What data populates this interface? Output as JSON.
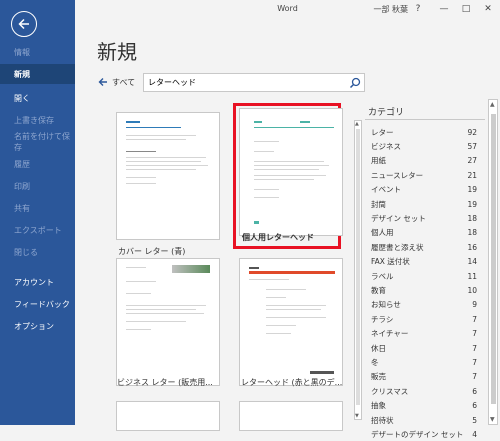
{
  "window": {
    "title": "Word",
    "user": "一部 秋葉",
    "help": "?",
    "minimize": "—",
    "maximize": "□",
    "close": "✕"
  },
  "sidebar": {
    "items": [
      {
        "label": "情報",
        "state": "dim"
      },
      {
        "label": "新規",
        "state": "active"
      },
      {
        "label": "開く",
        "state": "normal"
      },
      {
        "label": "上書き保存",
        "state": "dim"
      },
      {
        "label": "名前を付けて保存",
        "state": "dim"
      },
      {
        "label": "履歴",
        "state": "dim"
      },
      {
        "label": "印刷",
        "state": "dim"
      },
      {
        "label": "共有",
        "state": "dim"
      },
      {
        "label": "エクスポート",
        "state": "dim"
      },
      {
        "label": "閉じる",
        "state": "dim"
      },
      {
        "label": "アカウント",
        "state": "normal"
      },
      {
        "label": "フィードバック",
        "state": "normal"
      },
      {
        "label": "オプション",
        "state": "normal"
      }
    ]
  },
  "main": {
    "heading": "新規",
    "back_all": "すべて",
    "search_value": "レターヘッド"
  },
  "templates": [
    {
      "label": "カバー レター (青)"
    },
    {
      "label": "個人用レターヘッド"
    },
    {
      "label": "ビジネス レター (販売用..."
    },
    {
      "label": "レターヘッド (赤と黒のデ..."
    }
  ],
  "category_panel": {
    "title": "カテゴリ",
    "items": [
      {
        "name": "レター",
        "count": "92"
      },
      {
        "name": "ビジネス",
        "count": "57"
      },
      {
        "name": "用紙",
        "count": "27"
      },
      {
        "name": "ニュースレター",
        "count": "21"
      },
      {
        "name": "イベント",
        "count": "19"
      },
      {
        "name": "封筒",
        "count": "19"
      },
      {
        "name": "デザイン セット",
        "count": "18"
      },
      {
        "name": "個人用",
        "count": "18"
      },
      {
        "name": "履歴書と添え状",
        "count": "16"
      },
      {
        "name": "FAX 送付状",
        "count": "14"
      },
      {
        "name": "ラベル",
        "count": "11"
      },
      {
        "name": "教育",
        "count": "10"
      },
      {
        "name": "お知らせ",
        "count": "9"
      },
      {
        "name": "チラシ",
        "count": "7"
      },
      {
        "name": "ネイチャー",
        "count": "7"
      },
      {
        "name": "休日",
        "count": "7"
      },
      {
        "name": "冬",
        "count": "7"
      },
      {
        "name": "販売",
        "count": "7"
      },
      {
        "name": "クリスマス",
        "count": "6"
      },
      {
        "name": "抽象",
        "count": "6"
      },
      {
        "name": "招待状",
        "count": "5"
      },
      {
        "name": "デザートのデザイン セット",
        "count": "4"
      }
    ]
  },
  "colors": {
    "sidebar": "#2b579a",
    "active": "#1e4577",
    "highlight": "#e81123"
  }
}
